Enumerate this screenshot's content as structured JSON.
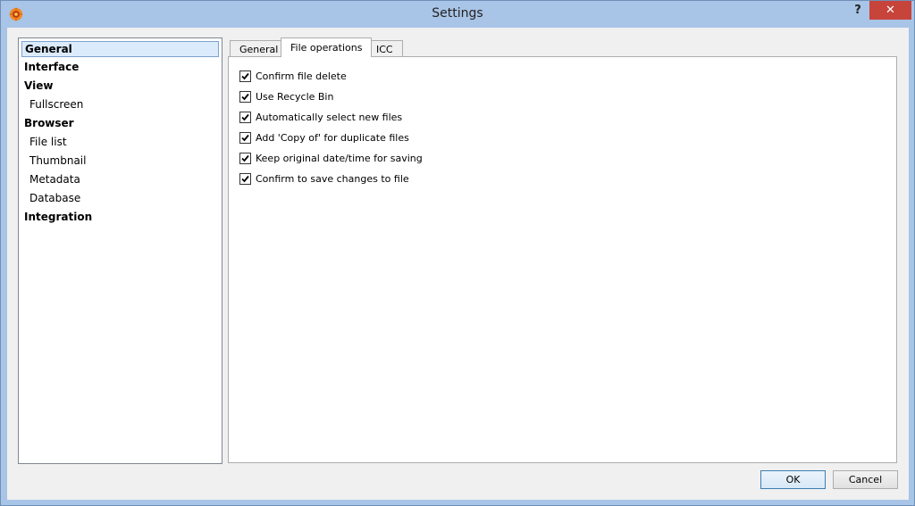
{
  "window": {
    "title": "Settings",
    "help_label": "?",
    "close_label": "✕"
  },
  "nav": {
    "items": [
      {
        "label": "General",
        "level": 0,
        "selected": true
      },
      {
        "label": "Interface",
        "level": 0
      },
      {
        "label": "View",
        "level": 0
      },
      {
        "label": "Fullscreen",
        "level": 1
      },
      {
        "label": "Browser",
        "level": 0
      },
      {
        "label": "File list",
        "level": 1
      },
      {
        "label": "Thumbnail",
        "level": 1
      },
      {
        "label": "Metadata",
        "level": 1
      },
      {
        "label": "Database",
        "level": 1
      },
      {
        "label": "Integration",
        "level": 0
      }
    ]
  },
  "tabs": [
    {
      "label": "General"
    },
    {
      "label": "File operations",
      "active": true
    },
    {
      "label": "ICC"
    }
  ],
  "options": [
    {
      "label": "Confirm file delete",
      "checked": true
    },
    {
      "label": "Use Recycle Bin",
      "checked": true
    },
    {
      "label": "Automatically select new files",
      "checked": true
    },
    {
      "label": "Add 'Copy of' for duplicate files",
      "checked": true
    },
    {
      "label": "Keep original date/time for saving",
      "checked": true
    },
    {
      "label": "Confirm to save changes to file",
      "checked": true
    }
  ],
  "buttons": {
    "ok_label": "OK",
    "cancel_label": "Cancel"
  }
}
